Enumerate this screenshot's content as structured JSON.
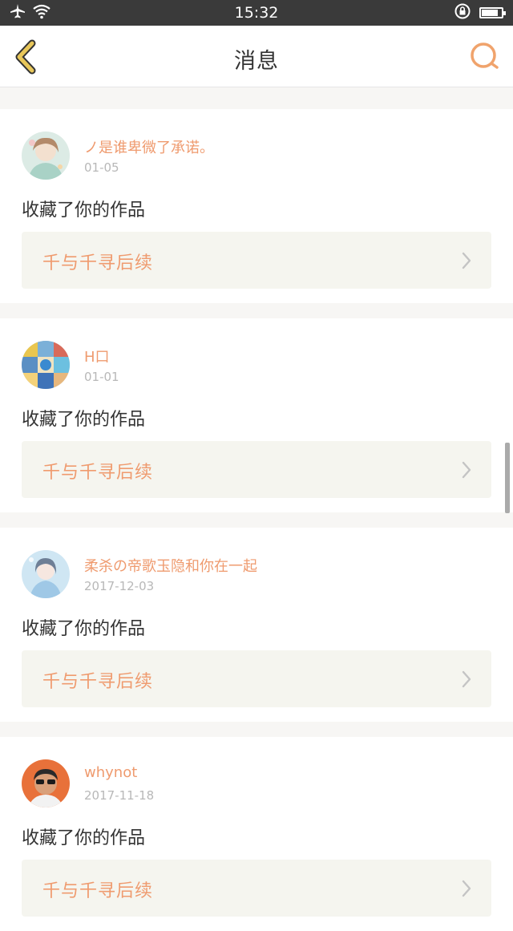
{
  "status_bar": {
    "time": "15:32",
    "battery_level": 0.85
  },
  "nav": {
    "title": "消息"
  },
  "messages": [
    {
      "username": "ノ是谁卑微了承诺。",
      "date": "01-05",
      "action": "收藏了你的作品",
      "work_title": "千与千寻后续"
    },
    {
      "username": "H口",
      "date": "01-01",
      "action": "收藏了你的作品",
      "work_title": "千与千寻后续"
    },
    {
      "username": "柔杀の帝歌玉隐和你在一起",
      "date": "2017-12-03",
      "action": "收藏了你的作品",
      "work_title": "千与千寻后续"
    },
    {
      "username": "whynot",
      "date": "2017-11-18",
      "action": "收藏了你的作品",
      "work_title": "千与千寻后续"
    }
  ],
  "colors": {
    "accent": "#ef9b6f",
    "back_icon": "#e8c75a",
    "search_icon": "#f0a36c"
  }
}
